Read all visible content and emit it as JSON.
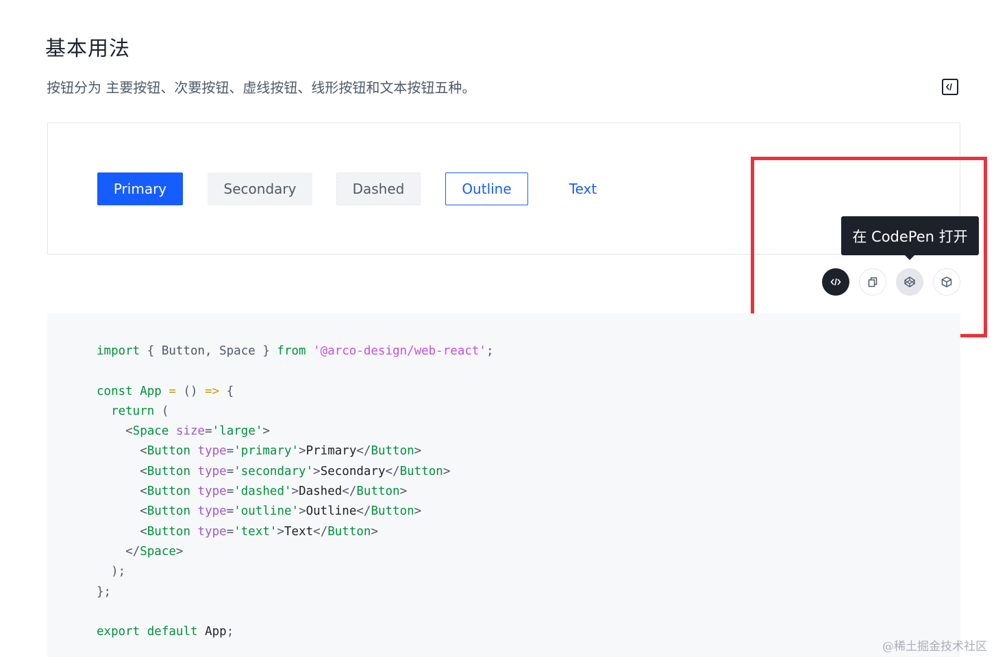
{
  "section": {
    "title": "基本用法",
    "description": "按钮分为 主要按钮、次要按钮、虚线按钮、线形按钮和文本按钮五种。"
  },
  "demo_buttons": {
    "primary": "Primary",
    "secondary": "Secondary",
    "dashed": "Dashed",
    "outline": "Outline",
    "text": "Text"
  },
  "tooltip": {
    "text": "在 CodePen 打开"
  },
  "actions": [
    {
      "name": "show-code",
      "icon": "code-icon"
    },
    {
      "name": "copy",
      "icon": "copy-icon"
    },
    {
      "name": "codepen",
      "icon": "codepen-icon"
    },
    {
      "name": "codesandbox",
      "icon": "codesandbox-icon"
    }
  ],
  "code": {
    "import_kw": "import",
    "import_names": " { Button, Space } ",
    "from_kw": "from",
    "module": "'@arco-design/web-react'",
    "const_kw": "const",
    "app_name": "App",
    "return_kw": "return",
    "space_tag": "Space",
    "size_attr": "size",
    "size_val": "'large'",
    "button_tag": "Button",
    "type_attr": "type",
    "btn_types": [
      "'primary'",
      "'secondary'",
      "'dashed'",
      "'outline'",
      "'text'"
    ],
    "btn_labels": [
      "Primary",
      "Secondary",
      "Dashed",
      "Outline",
      "Text"
    ],
    "export_kw": "export",
    "default_kw": "default"
  },
  "colors": {
    "primary": "#165dff",
    "tooltip_bg": "#1d2129",
    "highlight": "#e8333b",
    "code_bg": "#f7f8fa"
  },
  "watermark": "@稀土掘金技术社区"
}
